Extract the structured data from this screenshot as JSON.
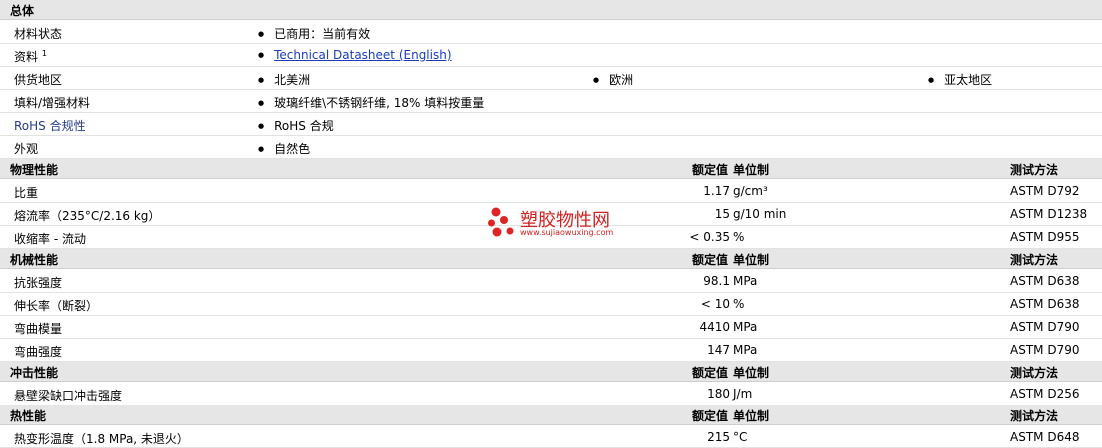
{
  "sections": {
    "general": {
      "title": "总体",
      "rows": [
        {
          "label": "材料状态",
          "values": [
            "已商用：当前有效"
          ]
        },
        {
          "label": "资料",
          "sup": "1",
          "values": [
            "Technical Datasheet (English)"
          ]
        },
        {
          "label": "供货地区",
          "values": [
            "北美洲",
            "欧洲",
            "亚太地区"
          ]
        },
        {
          "label": "填料/增强材料",
          "values": [
            "玻璃纤维\\不锈钢纤维, 18% 填料按重量"
          ]
        },
        {
          "label": "RoHS 合规性",
          "values": [
            "RoHS 合规"
          ]
        },
        {
          "label": "外观",
          "values": [
            "自然色"
          ]
        }
      ]
    },
    "physical": {
      "title": "物理性能",
      "col_value": "额定值",
      "col_unit": "单位制",
      "col_method": "测试方法",
      "rows": [
        {
          "label": "比重",
          "value": "1.17",
          "unit": "g/cm³",
          "method": "ASTM D792"
        },
        {
          "label": "熔流率（235°C/2.16 kg）",
          "value": "15",
          "unit": "g/10 min",
          "method": "ASTM D1238"
        },
        {
          "label": "收缩率 - 流动",
          "value": "< 0.35",
          "unit": "%",
          "method": "ASTM D955"
        }
      ]
    },
    "mechanical": {
      "title": "机械性能",
      "col_value": "额定值",
      "col_unit": "单位制",
      "col_method": "测试方法",
      "rows": [
        {
          "label": "抗张强度",
          "value": "98.1",
          "unit": "MPa",
          "method": "ASTM D638"
        },
        {
          "label": "伸长率（断裂）",
          "value": "< 10",
          "unit": "%",
          "method": "ASTM D638"
        },
        {
          "label": "弯曲模量",
          "value": "4410",
          "unit": "MPa",
          "method": "ASTM D790"
        },
        {
          "label": "弯曲强度",
          "value": "147",
          "unit": "MPa",
          "method": "ASTM D790"
        }
      ]
    },
    "impact": {
      "title": "冲击性能",
      "col_value": "额定值",
      "col_unit": "单位制",
      "col_method": "测试方法",
      "rows": [
        {
          "label": "悬壁梁缺口冲击强度",
          "value": "180",
          "unit": "J/m",
          "method": "ASTM D256"
        }
      ]
    },
    "thermal": {
      "title": "热性能",
      "col_value": "额定值",
      "col_unit": "单位制",
      "col_method": "测试方法",
      "rows": [
        {
          "label": "热变形温度（1.8 MPa, 未退火）",
          "value": "215",
          "unit": "°C",
          "method": "ASTM D648"
        }
      ]
    }
  },
  "watermark": {
    "title": "塑胶物性网",
    "url": "www.sujiaowuxing.com",
    "color": "#d42020"
  },
  "colors": {
    "header_bg": "#e6e6e6",
    "link": "#1a3cbd",
    "label_blue": "#243c8c"
  }
}
